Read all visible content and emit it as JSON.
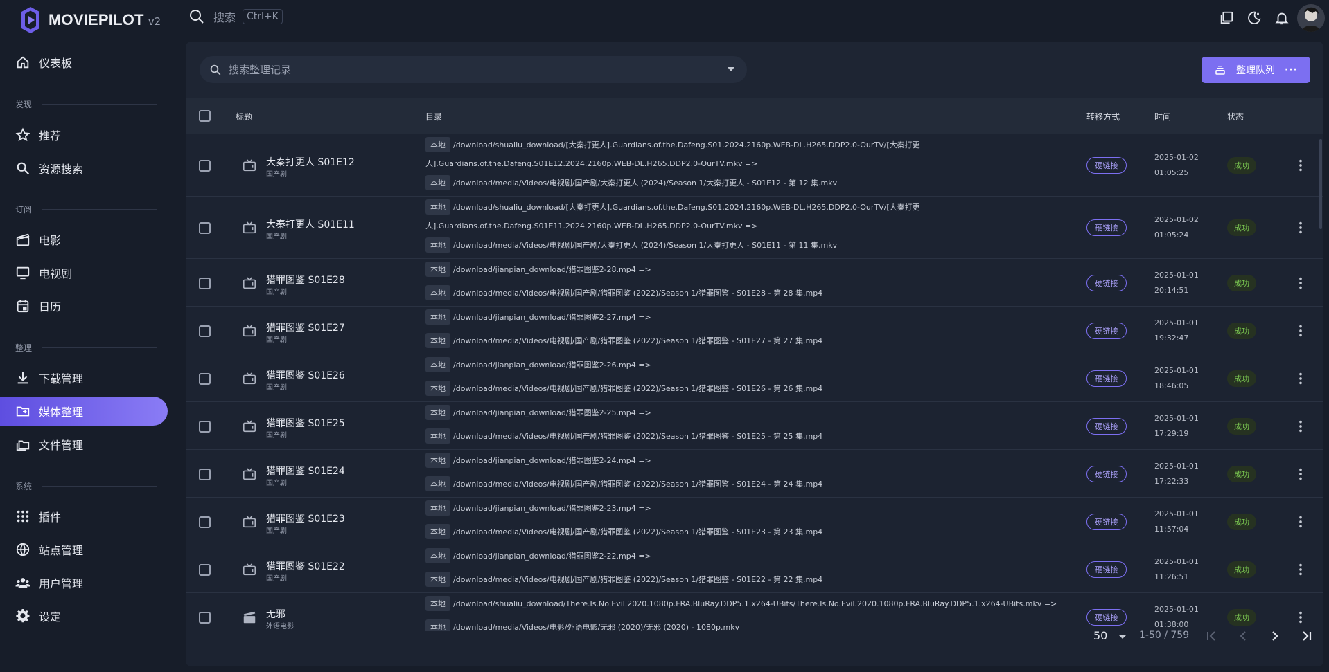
{
  "brand": {
    "name": "MOVIEPILOT",
    "version": "v2"
  },
  "topbar": {
    "search_label": "搜索",
    "shortcut": "Ctrl+K"
  },
  "sidebar": {
    "dashboard": "仪表板",
    "sections": {
      "discover": "发现",
      "subscribe": "订阅",
      "organize": "整理",
      "system": "系统"
    },
    "items": {
      "recommend": "推荐",
      "resource_search": "资源搜索",
      "movies": "电影",
      "tv": "电视剧",
      "calendar": "日历",
      "download": "下载管理",
      "media_organize": "媒体整理",
      "file_manage": "文件管理",
      "plugins": "插件",
      "sites": "站点管理",
      "users": "用户管理",
      "settings": "设定"
    },
    "active": "media_organize"
  },
  "toolbar": {
    "filter_placeholder": "搜索整理记录",
    "queue_label": "整理队列",
    "queue_more": "···"
  },
  "table": {
    "headers": {
      "title": "标题",
      "dir": "目录",
      "method": "转移方式",
      "time": "时间",
      "status": "状态"
    },
    "rows": [
      {
        "title": "大秦打更人 S01E12",
        "category": "国产剧",
        "type": "tv",
        "src_loc": "本地",
        "src": "/download/shualiu_download/[大秦打更人].Guardians.of.the.Dafeng.S01.2024.2160p.WEB-DL.H265.DDP2.0-OurTV/[大秦打更",
        "src_cont": "人].Guardians.of.the.Dafeng.S01E12.2024.2160p.WEB-DL.H265.DDP2.0-OurTV.mkv =>",
        "dst_loc": "本地",
        "dst": "/download/media/Videos/电视剧/国产剧/大秦打更人 (2024)/Season 1/大秦打更人 - S01E12 - 第 12 集.mkv",
        "method": "硬链接",
        "date": "2025-01-02",
        "clock": "01:05:25",
        "status": "成功"
      },
      {
        "title": "大秦打更人 S01E11",
        "category": "国产剧",
        "type": "tv",
        "src_loc": "本地",
        "src": "/download/shualiu_download/[大秦打更人].Guardians.of.the.Dafeng.S01.2024.2160p.WEB-DL.H265.DDP2.0-OurTV/[大秦打更",
        "src_cont": "人].Guardians.of.the.Dafeng.S01E11.2024.2160p.WEB-DL.H265.DDP2.0-OurTV.mkv =>",
        "dst_loc": "本地",
        "dst": "/download/media/Videos/电视剧/国产剧/大秦打更人 (2024)/Season 1/大秦打更人 - S01E11 - 第 11 集.mkv",
        "method": "硬链接",
        "date": "2025-01-02",
        "clock": "01:05:24",
        "status": "成功"
      },
      {
        "title": "猎罪图鉴 S01E28",
        "category": "国产剧",
        "type": "tv",
        "src_loc": "本地",
        "src": "/download/jianpian_download/猎罪图鉴2-28.mp4 =>",
        "dst_loc": "本地",
        "dst": "/download/media/Videos/电视剧/国产剧/猎罪图鉴 (2022)/Season 1/猎罪图鉴 - S01E28 - 第 28 集.mp4",
        "method": "硬链接",
        "date": "2025-01-01",
        "clock": "20:14:51",
        "status": "成功"
      },
      {
        "title": "猎罪图鉴 S01E27",
        "category": "国产剧",
        "type": "tv",
        "src_loc": "本地",
        "src": "/download/jianpian_download/猎罪图鉴2-27.mp4 =>",
        "dst_loc": "本地",
        "dst": "/download/media/Videos/电视剧/国产剧/猎罪图鉴 (2022)/Season 1/猎罪图鉴 - S01E27 - 第 27 集.mp4",
        "method": "硬链接",
        "date": "2025-01-01",
        "clock": "19:32:47",
        "status": "成功"
      },
      {
        "title": "猎罪图鉴 S01E26",
        "category": "国产剧",
        "type": "tv",
        "src_loc": "本地",
        "src": "/download/jianpian_download/猎罪图鉴2-26.mp4 =>",
        "dst_loc": "本地",
        "dst": "/download/media/Videos/电视剧/国产剧/猎罪图鉴 (2022)/Season 1/猎罪图鉴 - S01E26 - 第 26 集.mp4",
        "method": "硬链接",
        "date": "2025-01-01",
        "clock": "18:46:05",
        "status": "成功"
      },
      {
        "title": "猎罪图鉴 S01E25",
        "category": "国产剧",
        "type": "tv",
        "src_loc": "本地",
        "src": "/download/jianpian_download/猎罪图鉴2-25.mp4 =>",
        "dst_loc": "本地",
        "dst": "/download/media/Videos/电视剧/国产剧/猎罪图鉴 (2022)/Season 1/猎罪图鉴 - S01E25 - 第 25 集.mp4",
        "method": "硬链接",
        "date": "2025-01-01",
        "clock": "17:29:19",
        "status": "成功"
      },
      {
        "title": "猎罪图鉴 S01E24",
        "category": "国产剧",
        "type": "tv",
        "src_loc": "本地",
        "src": "/download/jianpian_download/猎罪图鉴2-24.mp4 =>",
        "dst_loc": "本地",
        "dst": "/download/media/Videos/电视剧/国产剧/猎罪图鉴 (2022)/Season 1/猎罪图鉴 - S01E24 - 第 24 集.mp4",
        "method": "硬链接",
        "date": "2025-01-01",
        "clock": "17:22:33",
        "status": "成功"
      },
      {
        "title": "猎罪图鉴 S01E23",
        "category": "国产剧",
        "type": "tv",
        "src_loc": "本地",
        "src": "/download/jianpian_download/猎罪图鉴2-23.mp4 =>",
        "dst_loc": "本地",
        "dst": "/download/media/Videos/电视剧/国产剧/猎罪图鉴 (2022)/Season 1/猎罪图鉴 - S01E23 - 第 23 集.mp4",
        "method": "硬链接",
        "date": "2025-01-01",
        "clock": "11:57:04",
        "status": "成功"
      },
      {
        "title": "猎罪图鉴 S01E22",
        "category": "国产剧",
        "type": "tv",
        "src_loc": "本地",
        "src": "/download/jianpian_download/猎罪图鉴2-22.mp4 =>",
        "dst_loc": "本地",
        "dst": "/download/media/Videos/电视剧/国产剧/猎罪图鉴 (2022)/Season 1/猎罪图鉴 - S01E22 - 第 22 集.mp4",
        "method": "硬链接",
        "date": "2025-01-01",
        "clock": "11:26:51",
        "status": "成功"
      },
      {
        "title": "无邪",
        "category": "外语电影",
        "type": "movie",
        "src_loc": "本地",
        "src": "/download/shualiu_download/There.Is.No.Evil.2020.1080p.FRA.BluRay.DDP5.1.x264-UBits/There.Is.No.Evil.2020.1080p.FRA.BluRay.DDP5.1.x264-UBits.mkv =>",
        "dst_loc": "本地",
        "dst": "/download/media/Videos/电影/外语电影/无邪 (2020)/无邪 (2020) - 1080p.mkv",
        "method": "硬链接",
        "date": "2025-01-01",
        "clock": "01:38:00",
        "status": "成功"
      }
    ]
  },
  "pagination": {
    "per_page": "50",
    "range": "1-50 / 759"
  },
  "colors": {
    "accent": "#7c6ff1",
    "success": "#79c450",
    "background": "#171d29",
    "panel": "#1e2533"
  }
}
